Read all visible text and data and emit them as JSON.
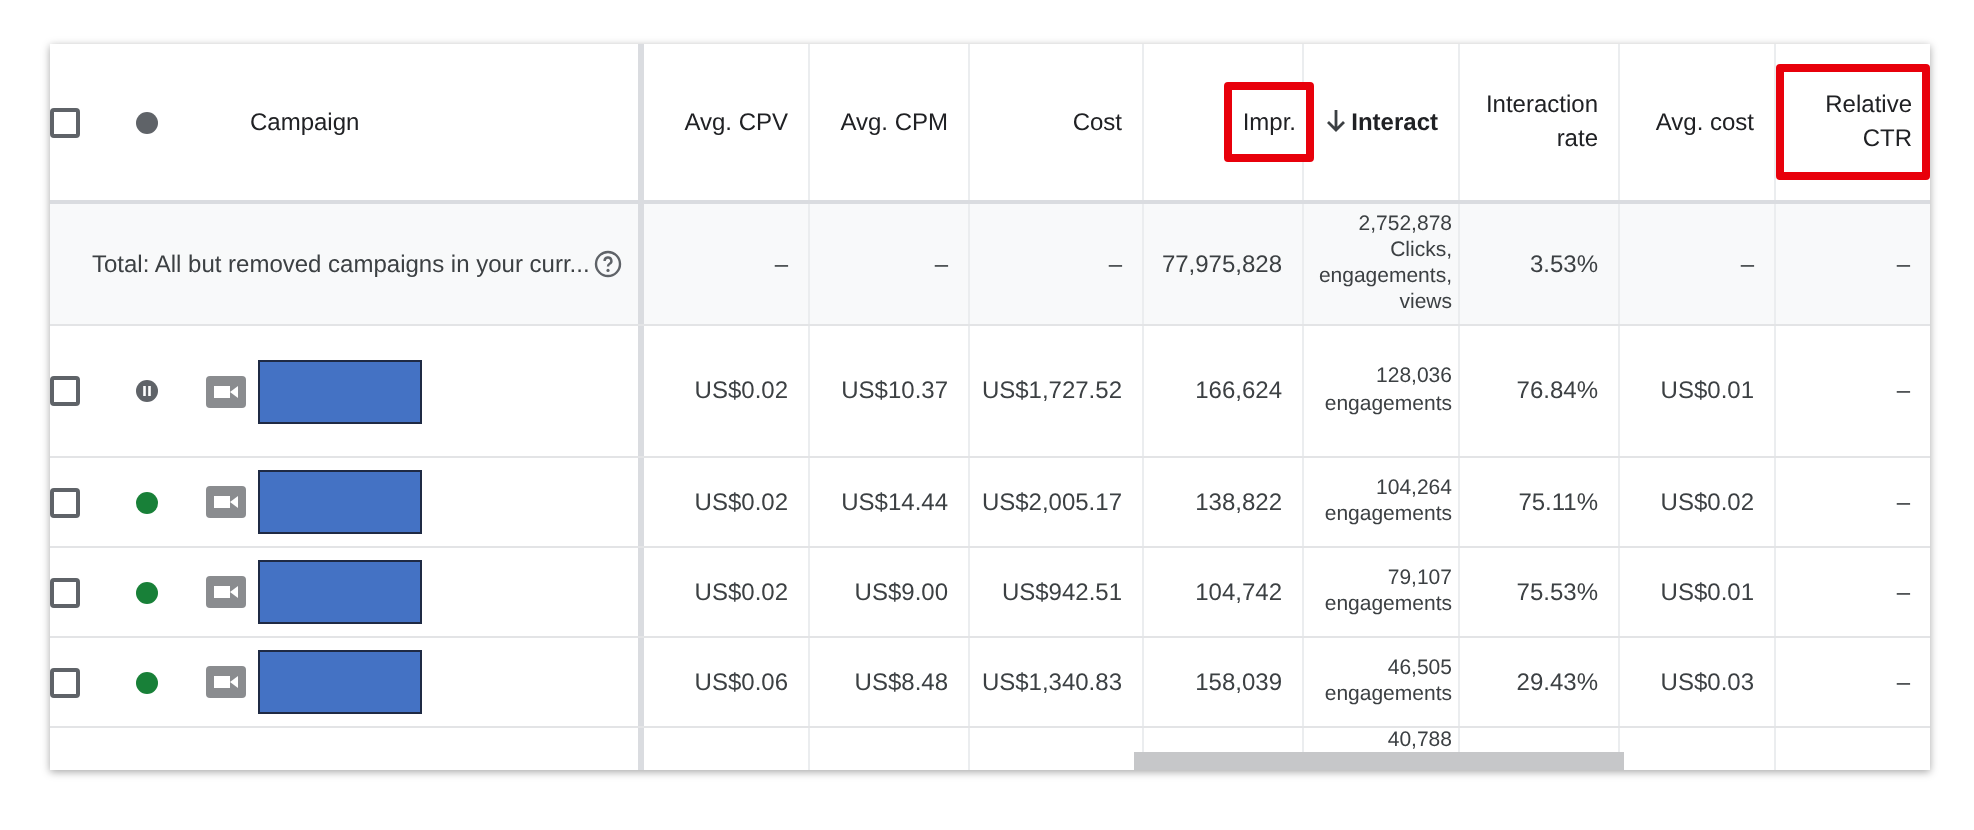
{
  "table": {
    "campaign_header": "Campaign",
    "header_checked": false,
    "columns": [
      {
        "label": "Avg. CPV",
        "highlighted": false,
        "sorted": false
      },
      {
        "label": "Avg. CPM",
        "highlighted": false,
        "sorted": false
      },
      {
        "label": "Cost",
        "highlighted": false,
        "sorted": false
      },
      {
        "label": "Impr.",
        "highlighted": true,
        "sorted": false
      },
      {
        "label": "Interact",
        "highlighted": false,
        "sorted": true
      },
      {
        "label": "Interaction rate",
        "highlighted": false,
        "sorted": false
      },
      {
        "label": "Avg. cost",
        "highlighted": false,
        "sorted": false
      },
      {
        "label": "Relative CTR",
        "highlighted": true,
        "sorted": false
      }
    ],
    "total": {
      "label": "Total: All but removed campaigns in your curr...",
      "cells": [
        "–",
        "–",
        "–",
        "77,975,828",
        "2,752,878\nClicks,\nengagements,\nviews",
        "3.53%",
        "–",
        "–"
      ]
    },
    "rows": [
      {
        "checked": false,
        "kind": "paused",
        "cells": [
          "US$0.02",
          "US$10.37",
          "US$1,727.52",
          "166,624",
          "128,036\nengagements",
          "76.84%",
          "US$0.01",
          "–"
        ]
      },
      {
        "checked": false,
        "kind": "enabled",
        "cells": [
          "US$0.02",
          "US$14.44",
          "US$2,005.17",
          "138,822",
          "104,264\nengagements",
          "75.11%",
          "US$0.02",
          "–"
        ]
      },
      {
        "checked": false,
        "kind": "enabled",
        "cells": [
          "US$0.02",
          "US$9.00",
          "US$942.51",
          "104,742",
          "79,107\nengagements",
          "75.53%",
          "US$0.01",
          "–"
        ]
      },
      {
        "checked": false,
        "kind": "enabled",
        "cells": [
          "US$0.06",
          "US$8.48",
          "US$1,340.83",
          "158,039",
          "46,505\nengagements",
          "29.43%",
          "US$0.03",
          "–"
        ]
      }
    ],
    "partial_row": {
      "interactions": "40,788"
    }
  }
}
